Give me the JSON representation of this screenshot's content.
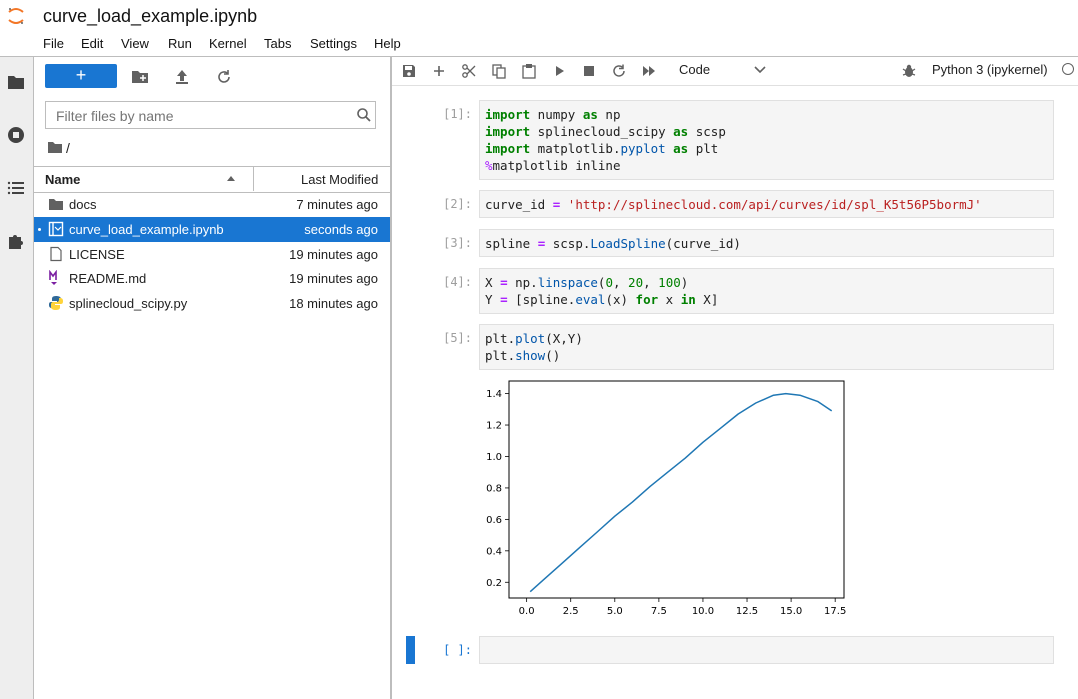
{
  "app": {
    "title": "curve_load_example.ipynb",
    "menu": [
      "File",
      "Edit",
      "View",
      "Run",
      "Kernel",
      "Tabs",
      "Settings",
      "Help"
    ]
  },
  "filebrowser": {
    "new_label": "+",
    "filter_placeholder": "Filter files by name",
    "breadcrumb": "/",
    "columns": {
      "name": "Name",
      "modified": "Last Modified"
    },
    "files": [
      {
        "name": "docs",
        "modified": "7 minutes ago",
        "icon": "folder-icon",
        "selected": false
      },
      {
        "name": "curve_load_example.ipynb",
        "modified": "seconds ago",
        "icon": "notebook-icon",
        "selected": true
      },
      {
        "name": "LICENSE",
        "modified": "19 minutes ago",
        "icon": "file-icon",
        "selected": false
      },
      {
        "name": "README.md",
        "modified": "19 minutes ago",
        "icon": "markdown-icon",
        "selected": false
      },
      {
        "name": "splinecloud_scipy.py",
        "modified": "18 minutes ago",
        "icon": "python-icon",
        "selected": false
      }
    ]
  },
  "notebook": {
    "cell_type": "Code",
    "kernel": "Python 3 (ipykernel)",
    "cells": [
      {
        "prompt": "[1]:",
        "lines": [
          "import numpy as np",
          "import splinecloud_scipy as scsp",
          "import matplotlib.pyplot as plt",
          "%matplotlib inline"
        ]
      },
      {
        "prompt": "[2]:",
        "lines": [
          "curve_id = 'http://splinecloud.com/api/curves/id/spl_K5t56P5bormJ'"
        ]
      },
      {
        "prompt": "[3]:",
        "lines": [
          "spline = scsp.LoadSpline(curve_id)"
        ]
      },
      {
        "prompt": "[4]:",
        "lines": [
          "X = np.linspace(0, 20, 100)",
          "Y = [spline.eval(x) for x in X]"
        ]
      },
      {
        "prompt": "[5]:",
        "lines": [
          "plt.plot(X,Y)",
          "plt.show()"
        ]
      },
      {
        "prompt": "[ ]:",
        "lines": [
          ""
        ]
      }
    ]
  },
  "chart_data": {
    "type": "line",
    "title": "",
    "xlabel": "",
    "ylabel": "",
    "xlim": [
      -1,
      18
    ],
    "ylim": [
      0.1,
      1.48
    ],
    "xticks": [
      0.0,
      2.5,
      5.0,
      7.5,
      10.0,
      12.5,
      15.0,
      17.5
    ],
    "xtick_labels": [
      "0.0",
      "2.5",
      "5.0",
      "7.5",
      "10.0",
      "12.5",
      "15.0",
      "17.5"
    ],
    "yticks": [
      0.2,
      0.4,
      0.6,
      0.8,
      1.0,
      1.2,
      1.4
    ],
    "ytick_labels": [
      "0.2",
      "0.4",
      "0.6",
      "0.8",
      "1.0",
      "1.2",
      "1.4"
    ],
    "color": "#1f77b4",
    "series": [
      {
        "x": [
          0.2,
          1.0,
          2.0,
          3.0,
          4.0,
          5.0,
          6.0,
          7.0,
          8.0,
          9.0,
          10.0,
          11.0,
          12.0,
          13.0,
          14.0,
          14.7,
          15.5,
          16.5,
          17.3
        ],
        "y": [
          0.14,
          0.22,
          0.32,
          0.42,
          0.52,
          0.62,
          0.71,
          0.81,
          0.9,
          0.99,
          1.09,
          1.18,
          1.27,
          1.34,
          1.39,
          1.4,
          1.39,
          1.35,
          1.29
        ]
      }
    ]
  }
}
